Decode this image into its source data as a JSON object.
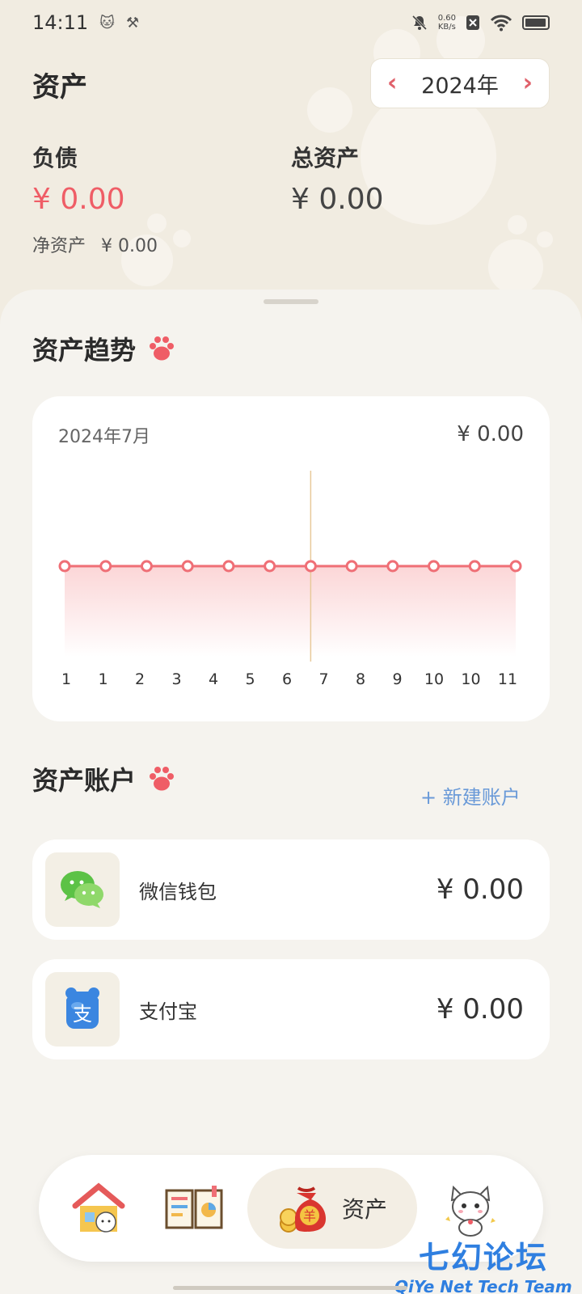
{
  "status_bar": {
    "time": "14:11",
    "net_speed_value": "0.60",
    "net_speed_unit": "KB/s",
    "icons": [
      "cat-app-icon",
      "tools-icon",
      "mute-bell-icon",
      "close-box-icon",
      "wifi-icon",
      "battery-icon"
    ]
  },
  "header": {
    "title": "资产",
    "year_label": "2024年",
    "prev_icon": "chevron-left-icon",
    "next_icon": "chevron-right-icon"
  },
  "summary": {
    "liabilities_label": "负债",
    "liabilities_value": "¥ 0.00",
    "total_assets_label": "总资产",
    "total_assets_value": "¥ 0.00",
    "net_assets_label": "净资产",
    "net_assets_value": "¥ 0.00",
    "colors": {
      "liabilities": "#ef5d66",
      "total": "#444444"
    }
  },
  "trend": {
    "title": "资产趋势",
    "title_icon": "paw-icon",
    "month_label": "2024年7月",
    "month_value": "¥ 0.00"
  },
  "chart_data": {
    "type": "area",
    "categories": [
      "1",
      "1",
      "2",
      "3",
      "4",
      "5",
      "6",
      "7",
      "8",
      "9",
      "10",
      "10",
      "11"
    ],
    "values": [
      0,
      0,
      0,
      0,
      0,
      0,
      0,
      0,
      0,
      0,
      0,
      0
    ],
    "title": "",
    "xlabel": "",
    "ylabel": "",
    "grid": false,
    "highlight_index": 6,
    "colors": {
      "line": "#ef6f76",
      "fill": "#fbd4d5",
      "cursor": "#e8c99a"
    }
  },
  "accounts": {
    "title": "资产账户",
    "title_icon": "paw-icon",
    "new_label": "+ 新建账户",
    "items": [
      {
        "name": "微信钱包",
        "balance": "¥ 0.00",
        "icon": "wechat-icon"
      },
      {
        "name": "支付宝",
        "balance": "¥ 0.00",
        "icon": "alipay-icon"
      }
    ]
  },
  "nav": {
    "items": [
      {
        "icon": "home-house-icon"
      },
      {
        "icon": "book-ledger-icon"
      },
      {
        "icon": "money-bag-icon",
        "label": "资产",
        "active": true
      },
      {
        "icon": "cat-mascot-icon"
      }
    ]
  },
  "watermark": {
    "cn": "七幻论坛",
    "en": "QiYe Net Tech Team"
  }
}
